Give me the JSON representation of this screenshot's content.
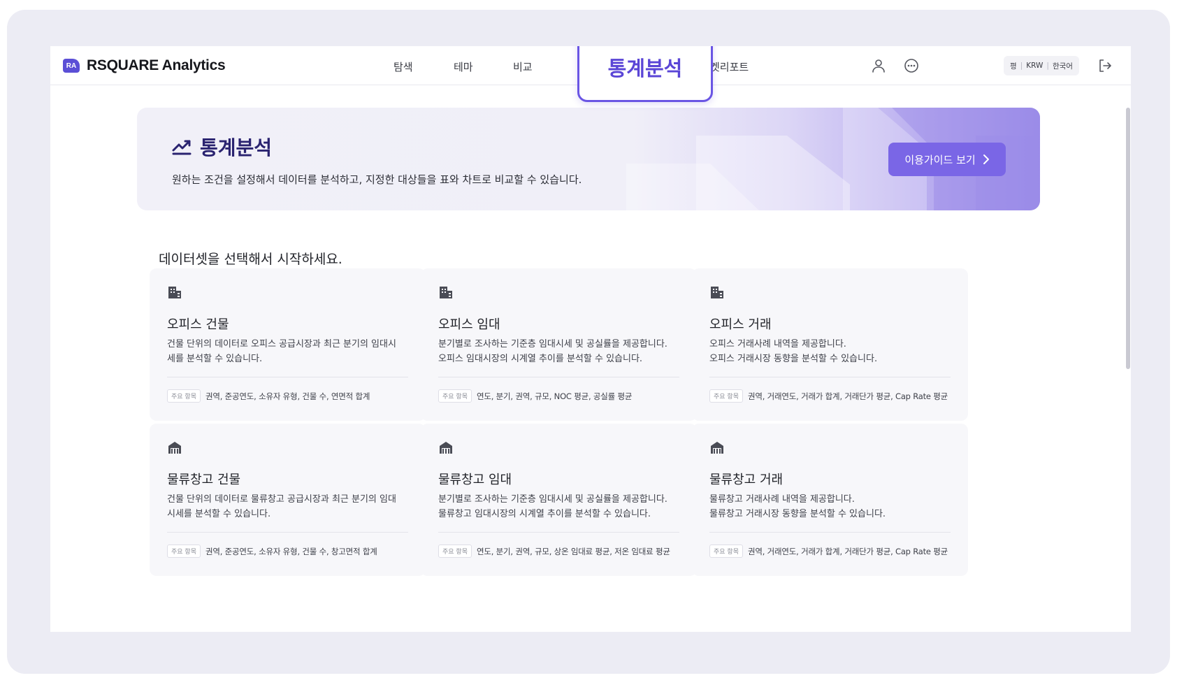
{
  "app": {
    "logo_badge": "RA",
    "logo_text": "RSQUARE Analytics"
  },
  "nav": {
    "items": [
      "탐색",
      "테마",
      "비교"
    ],
    "active": "통계분석",
    "after": "켓리포트"
  },
  "header": {
    "locale_unit": "평",
    "locale_currency": "KRW",
    "locale_language": "한국어"
  },
  "banner": {
    "title": "통계분석",
    "description": "원하는 조건을 설정해서 데이터를 분석하고, 지정한 대상들을 표와 차트로 비교할 수 있습니다.",
    "guide_button": "이용가이드 보기"
  },
  "section": {
    "title": "데이터셋을 선택해서 시작하세요."
  },
  "cards": [
    {
      "icon": "building-icon",
      "title": "오피스 건물",
      "description": "건물 단위의 데이터로 오피스 공급시장과 최근 분기의 임대시\n세를 분석할 수 있습니다.",
      "tag": "주요 항목",
      "fields": "권역, 준공연도, 소유자 유형, 건물 수, 연면적 합계"
    },
    {
      "icon": "building-icon",
      "title": "오피스 임대",
      "description": "분기별로 조사하는 기준층 임대시세 및 공실률을 제공합니다.\n오피스 임대시장의 시계열 추이를 분석할 수 있습니다.",
      "tag": "주요 항목",
      "fields": "연도, 분기, 권역, 규모, NOC 평균, 공실률 평균"
    },
    {
      "icon": "building-icon",
      "title": "오피스 거래",
      "description": "오피스 거래사례 내역을 제공합니다.\n오피스 거래시장 동향을 분석할 수 있습니다.",
      "tag": "주요 항목",
      "fields": "권역, 거래연도, 거래가 합계, 거래단가 평균, Cap Rate 평균"
    },
    {
      "icon": "warehouse-icon",
      "title": "물류창고 건물",
      "description": "건물 단위의 데이터로 물류창고 공급시장과 최근 분기의 임대\n시세를 분석할 수 있습니다.",
      "tag": "주요 항목",
      "fields": "권역, 준공연도, 소유자 유형, 건물 수, 창고면적 합계"
    },
    {
      "icon": "warehouse-icon",
      "title": "물류창고 임대",
      "description": "분기별로 조사하는 기준층 임대시세 및 공실률을 제공합니다.\n물류창고 임대시장의 시계열 추이를 분석할 수 있습니다.",
      "tag": "주요 항목",
      "fields": "연도, 분기, 권역, 규모, 상온 임대료 평균, 저온 임대료 평균"
    },
    {
      "icon": "warehouse-icon",
      "title": "물류창고 거래",
      "description": "물류창고 거래사례 내역을 제공합니다.\n물류창고 거래시장 동향을 분석할 수 있습니다.",
      "tag": "주요 항목",
      "fields": "권역, 거래연도, 거래가 합계, 거래단가 평균, Cap Rate 평균"
    }
  ],
  "colors": {
    "accent": "#6a55e4",
    "button": "#7a66e6",
    "title": "#2a2370"
  }
}
